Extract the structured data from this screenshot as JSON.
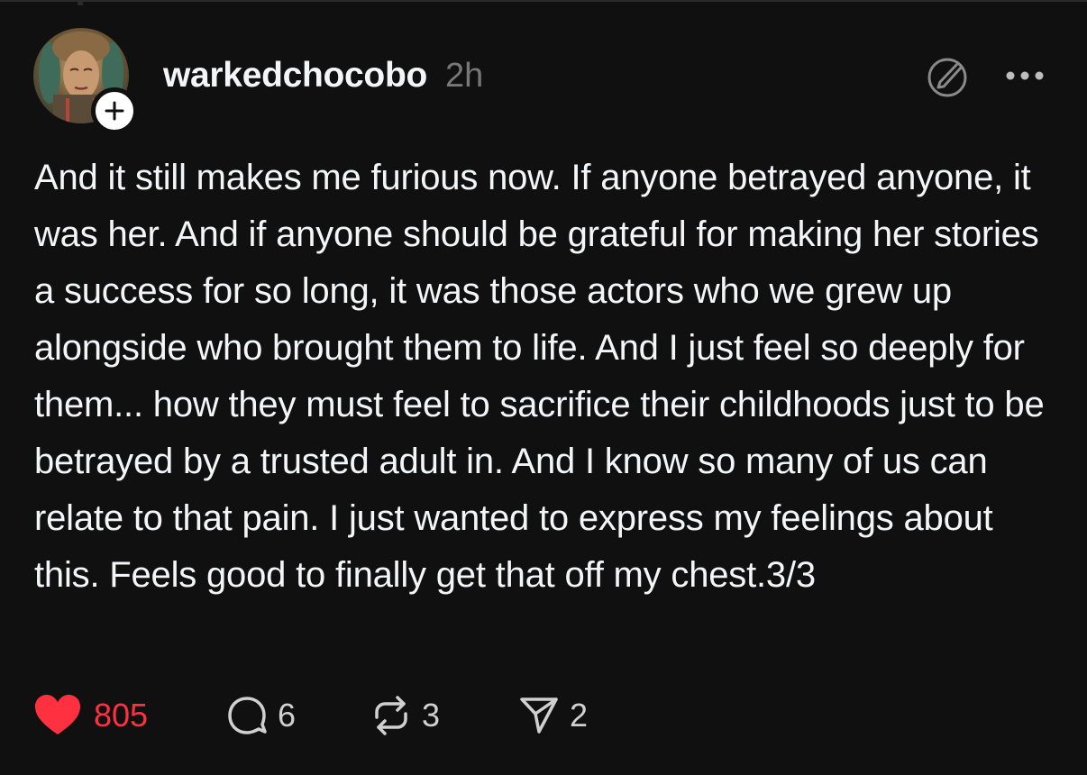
{
  "post": {
    "author": {
      "username": "warkedchocobo",
      "avatar_icon": "profile-avatar"
    },
    "timestamp": "2h",
    "text": "And it still makes me furious now. If anyone betrayed anyone, it was her. And if anyone should be grateful for making her stories a success for so long, it was those actors who we grew up alongside who brought them to life. And I just feel so deeply for them... how they must feel to sacrifice their childhoods just to be betrayed by a trusted adult in. And I know so many of us can relate to that pain. I just wanted to express my feelings about this. Feels good to finally get that off my chest.3/3",
    "actions": {
      "likes": "805",
      "replies": "6",
      "reposts": "3",
      "shares": "2"
    },
    "liked": true
  },
  "icons": {
    "follow": "plus-icon",
    "edit": "edit-icon",
    "more": "more-icon",
    "like": "heart-icon",
    "reply": "comment-icon",
    "repost": "repost-icon",
    "share": "send-icon"
  },
  "colors": {
    "background": "#101010",
    "text": "#f3f5f7",
    "muted": "#777777",
    "like": "#ff3040"
  }
}
